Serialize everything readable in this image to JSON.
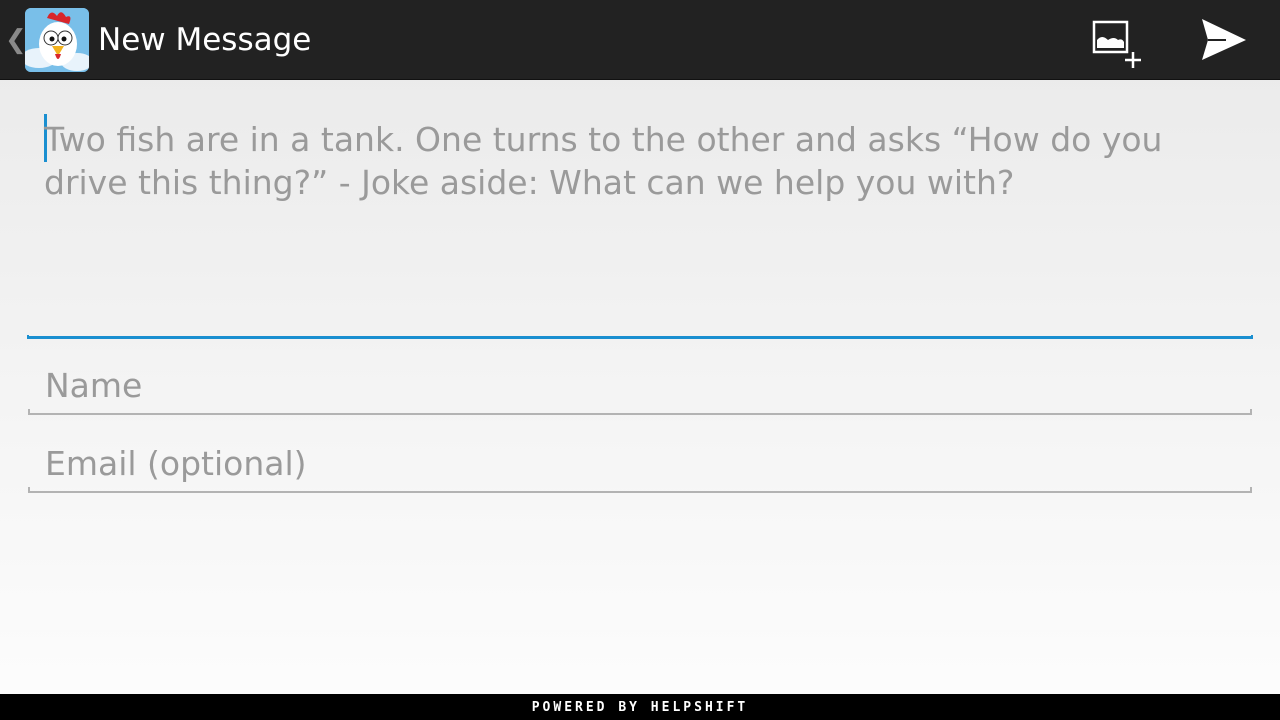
{
  "action_bar": {
    "title": "New Message",
    "up_icon": "chevron-left-icon",
    "app_icon": "chicken-app-icon",
    "attach_icon": "add-image-icon",
    "send_icon": "send-icon",
    "background_color": "#222222"
  },
  "form": {
    "message_hint": "Two fish are in a tank. One turns to the other and asks “How do you drive this thing?” - Joke aside: What can we help you with?",
    "name_hint": "Name",
    "email_hint": "Email (optional)",
    "accent_color": "#1a8fd0"
  },
  "footer": {
    "text": "POWERED BY HELPSHIFT"
  }
}
